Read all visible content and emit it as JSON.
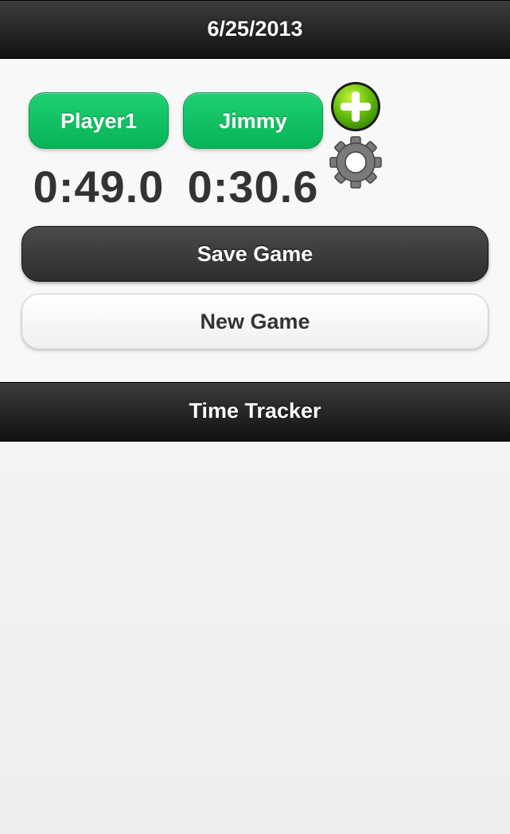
{
  "header": {
    "date": "6/25/2013"
  },
  "players": [
    {
      "name": "Player1",
      "time": "0:49.0"
    },
    {
      "name": "Jimmy",
      "time": "0:30.6"
    }
  ],
  "actions": {
    "add_icon": "plus-circle-icon",
    "settings_icon": "gear-icon",
    "save_label": "Save Game",
    "new_label": "New Game"
  },
  "footer": {
    "title": "Time Tracker"
  },
  "colors": {
    "accent_green": "#07b357",
    "bar_dark": "#1a1a1a",
    "timer_text": "#333333"
  }
}
